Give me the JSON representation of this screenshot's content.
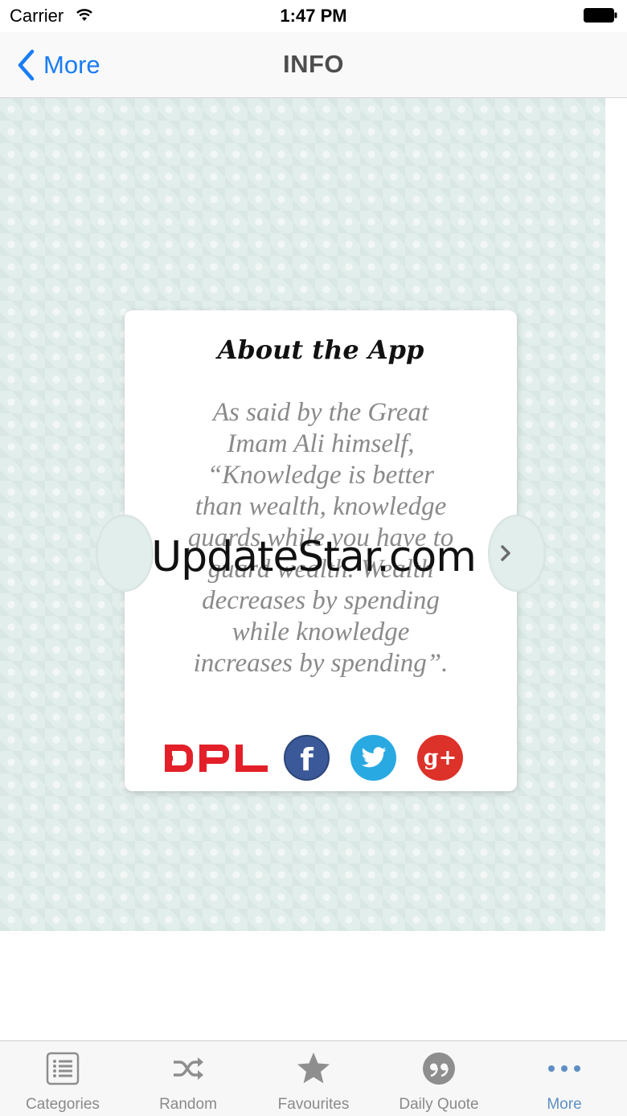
{
  "status_bar": {
    "carrier": "Carrier",
    "time": "1:47 PM"
  },
  "nav": {
    "back_label": "More",
    "title": "INFO"
  },
  "card": {
    "title": "About the App",
    "quote_lines": [
      "As said by the Great",
      "Imam Ali himself,",
      "“Knowledge is better",
      "than wealth, knowledge",
      "guards while you have to",
      "guard wealth. Wealth",
      "decreases by spending",
      "while knowledge",
      "increases by spending”."
    ],
    "logo_text": "DPL",
    "social": {
      "facebook": "f",
      "twitter": "twitter",
      "googleplus": "g+"
    }
  },
  "watermark": "UpdateStar.com",
  "tabs": [
    {
      "label": "Categories",
      "icon": "list-icon"
    },
    {
      "label": "Random",
      "icon": "shuffle-icon"
    },
    {
      "label": "Favourites",
      "icon": "star-icon"
    },
    {
      "label": "Daily Quote",
      "icon": "quote-icon"
    },
    {
      "label": "More",
      "icon": "more-dots-icon",
      "active": true
    }
  ],
  "colors": {
    "accent": "#1a7cf5",
    "tab_active": "#5e8fc4",
    "facebook": "#3b5998",
    "twitter": "#29a9e1",
    "googleplus": "#dc3229",
    "dpl_red": "#e3202a"
  }
}
